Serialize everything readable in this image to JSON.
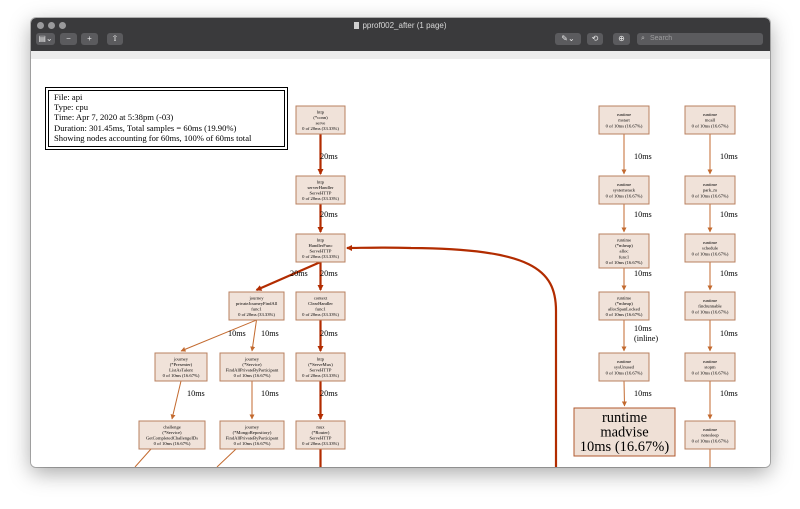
{
  "window": {
    "title": "pprof002_after (1 page)",
    "toolbar": {
      "sidebar_glyph": "▤⌄",
      "zoom_out_glyph": "−",
      "zoom_in_glyph": "+",
      "share_glyph": "⇧",
      "markup_glyph": "✎⌄",
      "rotate_glyph": "⟲",
      "annotate_glyph": "⊕",
      "search_placeholder": "Search"
    }
  },
  "info": {
    "file": "File: api",
    "type": "Type: cpu",
    "time": "Time: Apr 7, 2020 at 5:38pm (-03)",
    "duration": "Duration: 301.45ms, Total samples = 60ms (19.90%)",
    "showing": "Showing nodes accounting for 60ms, 100% of 60ms total"
  },
  "nodes": [
    {
      "id": "http-conn-serve",
      "lines": [
        "http",
        "(*conn)",
        "serve",
        "0 of 20ms (33.33%)"
      ]
    },
    {
      "id": "http-serverhandler-servehttp",
      "lines": [
        "http",
        "serverHandler",
        "ServeHTTP",
        "0 of 20ms (33.33%)"
      ]
    },
    {
      "id": "http-handlerfunc-servehttp",
      "lines": [
        "http",
        "HandlerFunc",
        "ServeHTTP",
        "0 of 20ms (33.33%)"
      ]
    },
    {
      "id": "journey-privatejourney-func1",
      "lines": [
        "journey",
        "privateJourneyFindAll",
        "func1",
        "0 of 20ms (33.33%)"
      ]
    },
    {
      "id": "context-clearhandler-func1",
      "lines": [
        "context",
        "ClearHandler",
        "func1",
        "0 of 20ms (33.33%)"
      ]
    },
    {
      "id": "journey-presenter-listastalent",
      "lines": [
        "journey",
        "(*Presenter)",
        "ListAsTalent",
        "0 of 10ms (16.67%)"
      ]
    },
    {
      "id": "journey-service-findall",
      "lines": [
        "journey",
        "(*Service)",
        "FindAllPrivateByParticipant",
        "0 of 10ms (16.67%)"
      ]
    },
    {
      "id": "http-servemux-servehttp",
      "lines": [
        "http",
        "(*ServeMux)",
        "ServeHTTP",
        "0 of 20ms (33.33%)"
      ]
    },
    {
      "id": "challenge-service-getcompleted",
      "lines": [
        "challenge",
        "(*Service)",
        "GetCompletedChallengeIDs",
        "0 of 10ms (16.67%)"
      ]
    },
    {
      "id": "journey-mongorepository-findall",
      "lines": [
        "journey",
        "(*MongoRepository)",
        "FindAllPrivateByParticipant",
        "0 of 10ms (16.67%)"
      ]
    },
    {
      "id": "mux-router-servehttp",
      "lines": [
        "mux",
        "(*Router)",
        "ServeHTTP",
        "0 of 20ms (33.33%)"
      ]
    },
    {
      "id": "runtime-mstart",
      "lines": [
        "runtime",
        "mstart",
        "0 of 10ms (16.67%)"
      ]
    },
    {
      "id": "runtime-systemstack",
      "lines": [
        "runtime",
        "systemstack",
        "0 of 10ms (16.67%)"
      ]
    },
    {
      "id": "runtime-mheap-alloc-func1",
      "lines": [
        "runtime",
        "(*mheap)",
        "alloc",
        "func1",
        "0 of 10ms (16.67%)"
      ]
    },
    {
      "id": "runtime-mheap-allocspan",
      "lines": [
        "runtime",
        "(*mheap)",
        "allocSpanLocked",
        "0 of 10ms (16.67%)"
      ]
    },
    {
      "id": "runtime-sysunused",
      "lines": [
        "runtime",
        "sysUnused",
        "0 of 10ms (16.67%)"
      ]
    },
    {
      "id": "runtime-madvise",
      "lines": [
        "runtime",
        "madvise",
        "10ms (16.67%)"
      ]
    },
    {
      "id": "runtime-mcall",
      "lines": [
        "runtime",
        "mcall",
        "0 of 10ms (16.67%)"
      ]
    },
    {
      "id": "runtime-park-m",
      "lines": [
        "runtime",
        "park_m",
        "0 of 10ms (16.67%)"
      ]
    },
    {
      "id": "runtime-schedule",
      "lines": [
        "runtime",
        "schedule",
        "0 of 10ms (16.67%)"
      ]
    },
    {
      "id": "runtime-findrunnable",
      "lines": [
        "runtime",
        "findrunnable",
        "0 of 10ms (16.67%)"
      ]
    },
    {
      "id": "runtime-stopm",
      "lines": [
        "runtime",
        "stopm",
        "0 of 10ms (16.67%)"
      ]
    },
    {
      "id": "runtime-notesleep",
      "lines": [
        "runtime",
        "notesleep",
        "0 of 10ms (16.67%)"
      ]
    }
  ],
  "edges": [
    {
      "from": "http-conn-serve",
      "to": "http-serverhandler-servehttp",
      "label": [
        "20ms"
      ],
      "weight": 20
    },
    {
      "from": "http-serverhandler-servehttp",
      "to": "http-handlerfunc-servehttp",
      "label": [
        "20ms"
      ],
      "weight": 20
    },
    {
      "from": "http-handlerfunc-servehttp",
      "to": "journey-privatejourney-func1",
      "label": [
        "20ms"
      ],
      "weight": 20
    },
    {
      "from": "http-handlerfunc-servehttp",
      "to": "context-clearhandler-func1",
      "label": [
        "20ms"
      ],
      "weight": 20
    },
    {
      "from": "journey-privatejourney-func1",
      "to": "journey-presenter-listastalent",
      "label": [
        "10ms"
      ],
      "weight": 10
    },
    {
      "from": "journey-privatejourney-func1",
      "to": "journey-service-findall",
      "label": [
        "10ms"
      ],
      "weight": 10
    },
    {
      "from": "context-clearhandler-func1",
      "to": "http-servemux-servehttp",
      "label": [
        "20ms"
      ],
      "weight": 20
    },
    {
      "from": "journey-presenter-listastalent",
      "to": "challenge-service-getcompleted",
      "label": [
        "10ms"
      ],
      "weight": 10
    },
    {
      "from": "journey-service-findall",
      "to": "journey-mongorepository-findall",
      "label": [
        "10ms"
      ],
      "weight": 10
    },
    {
      "from": "http-servemux-servehttp",
      "to": "mux-router-servehttp",
      "label": [
        "20ms"
      ],
      "weight": 20
    },
    {
      "from": "runtime-mstart",
      "to": "runtime-systemstack",
      "label": [
        "10ms"
      ],
      "weight": 10
    },
    {
      "from": "runtime-systemstack",
      "to": "runtime-mheap-alloc-func1",
      "label": [
        "10ms"
      ],
      "weight": 10
    },
    {
      "from": "runtime-mheap-alloc-func1",
      "to": "runtime-mheap-allocspan",
      "label": [
        "10ms"
      ],
      "weight": 10
    },
    {
      "from": "runtime-mheap-allocspan",
      "to": "runtime-sysunused",
      "label": [
        "10ms",
        "(inline)"
      ],
      "weight": 10
    },
    {
      "from": "runtime-sysunused",
      "to": "runtime-madvise",
      "label": [
        "10ms"
      ],
      "weight": 10
    },
    {
      "from": "runtime-mcall",
      "to": "runtime-park-m",
      "label": [
        "10ms"
      ],
      "weight": 10
    },
    {
      "from": "runtime-park-m",
      "to": "runtime-schedule",
      "label": [
        "10ms"
      ],
      "weight": 10
    },
    {
      "from": "runtime-schedule",
      "to": "runtime-findrunnable",
      "label": [
        "10ms"
      ],
      "weight": 10
    },
    {
      "from": "runtime-findrunnable",
      "to": "runtime-stopm",
      "label": [
        "10ms"
      ],
      "weight": 10
    },
    {
      "from": "runtime-stopm",
      "to": "runtime-notesleep",
      "label": [
        "10ms"
      ],
      "weight": 10
    },
    {
      "from": "mux-router-servehttp",
      "to": "http-handlerfunc-servehttp",
      "label": [],
      "weight": 20
    }
  ],
  "colors": {
    "node_fill": "#f0e2d9",
    "node_stroke": "#b9805f",
    "hot_node_fill": "#efe0d6",
    "hot_node_stroke": "#b25a2f",
    "edge_thick": "#b22c00",
    "edge_thin": "#c36a2f",
    "titlebar": "#3a3a3c"
  }
}
